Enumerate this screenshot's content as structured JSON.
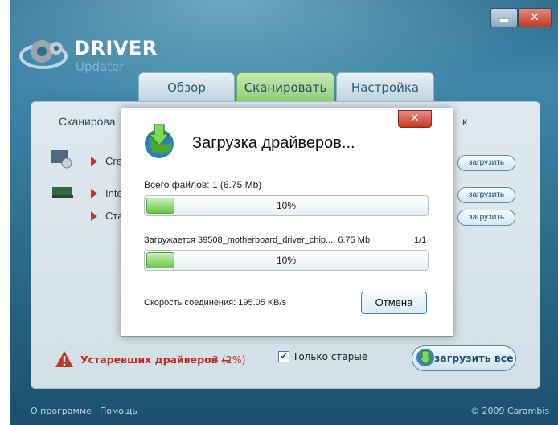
{
  "app": {
    "logo_title": "DRIVER",
    "logo_sub": "Updater",
    "close_glyph": "✕"
  },
  "tabs": [
    {
      "label": "Обзор",
      "active": false
    },
    {
      "label": "Сканировать",
      "active": true
    },
    {
      "label": "Настройка",
      "active": false
    }
  ],
  "background_panel": {
    "header_left": "Сканирова",
    "header_right": "к",
    "rows": [
      {
        "label": "Cre",
        "button": "загрузить"
      },
      {
        "label": "Inte",
        "button": "загрузить"
      },
      {
        "label": "Ста",
        "button": "загрузить"
      }
    ],
    "outdated_label": "Устаревших драйверов —",
    "outdated_count": "3 (2%)",
    "only_old_label": "Только старые",
    "download_all": "загрузить все"
  },
  "footer": {
    "about": "О программе",
    "help": "Помощь",
    "copyright": "© 2009 Carambis"
  },
  "modal": {
    "title": "Загрузка драйверов...",
    "close_glyph": "✕",
    "total_files_label": "Всего файлов:  1 (6.75 Mb)",
    "total_progress": {
      "percent_text": "10%",
      "fraction": 0.1
    },
    "current_file_label": "Загружается 39508_motherboard_driver_chip..., 6.75 Mb",
    "file_index": "1/1",
    "file_progress": {
      "percent_text": "10%",
      "fraction": 0.1
    },
    "speed_label": "Скорость соединения:  195.05 KB/s",
    "cancel": "Отмена"
  },
  "colors": {
    "accent_green": "#6cc54a",
    "warning_red": "#c02a1a",
    "window_blue": "#2d6a8a"
  }
}
